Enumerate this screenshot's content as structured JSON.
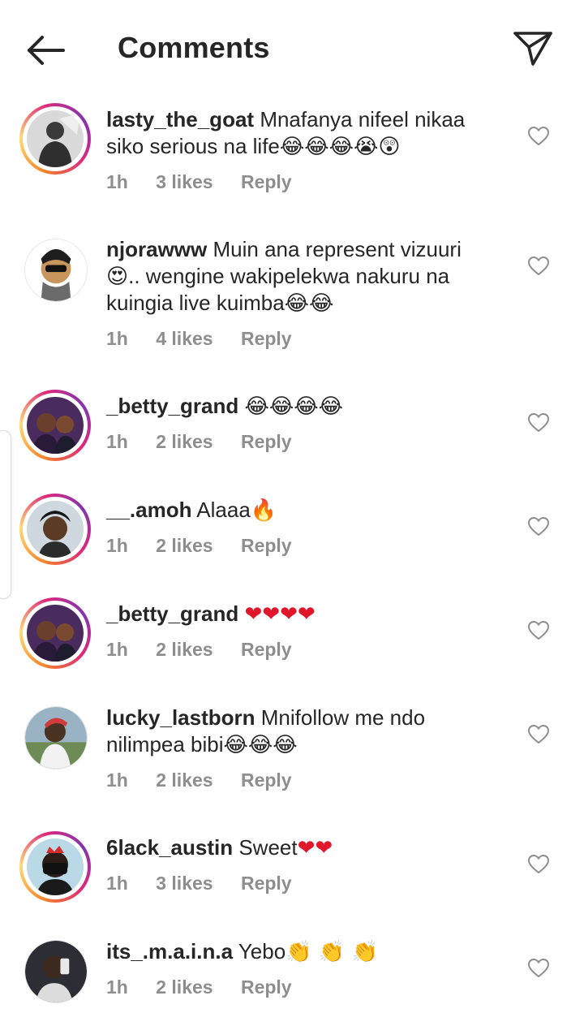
{
  "header": {
    "title": "Comments"
  },
  "comments": [
    {
      "username": "lasty_the_goat",
      "text": "Mnafanya nifeel nikaa siko serious na life",
      "emojis": "😂😂😂😭😲",
      "time": "1h",
      "likes": "3 likes",
      "reply": "Reply",
      "has_story_ring": true
    },
    {
      "username": "njorawww",
      "text_before": "Muin ana represent vizuuri",
      "emoji_mid": "😍",
      "text_after": ".. wengine wakipelekwa nakuru na kuingia live kuimba",
      "emojis": "😂😂",
      "time": "1h",
      "likes": "4 likes",
      "reply": "Reply",
      "has_story_ring": false
    },
    {
      "username": "_betty_grand",
      "text": "",
      "emojis": "😂😂😂😂",
      "time": "1h",
      "likes": "2 likes",
      "reply": "Reply",
      "has_story_ring": true
    },
    {
      "username": "__.amoh",
      "text": "Alaaa",
      "emojis": "🔥",
      "time": "1h",
      "likes": "2 likes",
      "reply": "Reply",
      "has_story_ring": true
    },
    {
      "username": "_betty_grand",
      "text": "",
      "emojis": "❤❤❤❤",
      "time": "1h",
      "likes": "2 likes",
      "reply": "Reply",
      "has_story_ring": true
    },
    {
      "username": "lucky_lastborn",
      "text": "Mnifollow me ndo nilimpea bibi",
      "emojis": "😂😂😂",
      "time": "1h",
      "likes": "2 likes",
      "reply": "Reply",
      "has_story_ring": false
    },
    {
      "username": "6lack_austin",
      "text": "Sweet",
      "emojis": "❤❤",
      "time": "1h",
      "likes": "3 likes",
      "reply": "Reply",
      "has_story_ring": true
    },
    {
      "username": "its_.m.a.i.n.a",
      "text": "Yebo",
      "emojis": "👏 👏 👏",
      "time": "1h",
      "likes": "2 likes",
      "reply": "Reply",
      "has_story_ring": false
    }
  ],
  "icons": {
    "back": "arrow-left-icon",
    "share": "send-paper-plane-icon",
    "like": "heart-outline-icon"
  },
  "colors": {
    "text": "#262626",
    "meta": "#8e8e8e",
    "heart_emoji": "#e0162b"
  }
}
